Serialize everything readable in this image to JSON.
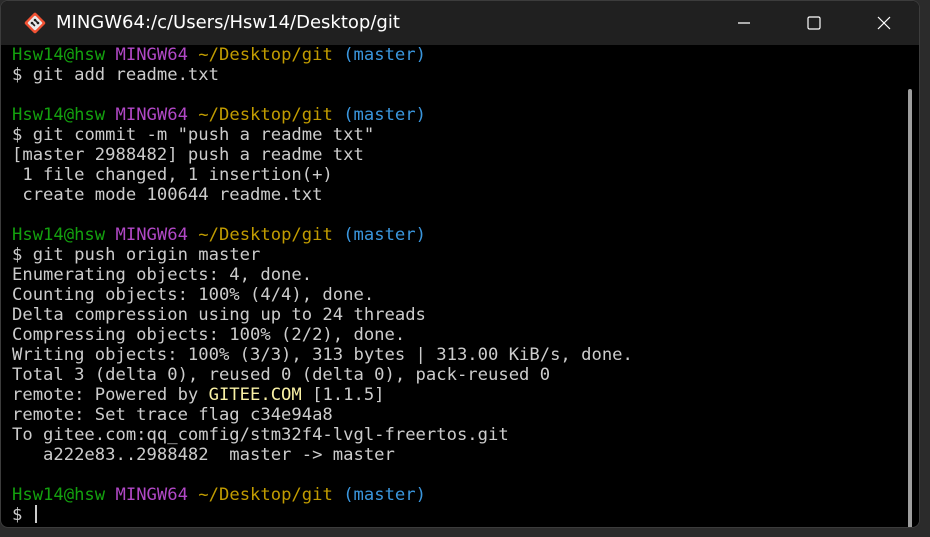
{
  "window": {
    "title": "MINGW64:/c/Users/Hsw14/Desktop/git",
    "app_icon": "git-bash-icon"
  },
  "controls": {
    "minimize_icon": "minimize-icon",
    "maximize_icon": "maximize-icon",
    "close_icon": "close-icon"
  },
  "colors": {
    "user": "#13a10e",
    "host": "#b148c6",
    "path": "#c19c00",
    "branch": "#3a96dd",
    "text": "#cccccc",
    "highlight": "#f9f1a5"
  },
  "prompt": {
    "user": "Hsw14@hsw",
    "host": "MINGW64",
    "path": "~/Desktop/git",
    "branch": "(master)",
    "symbol": "$"
  },
  "lines": [
    {
      "type": "prompt"
    },
    {
      "type": "cmd",
      "text": "git add readme.txt"
    },
    {
      "type": "blank"
    },
    {
      "type": "prompt"
    },
    {
      "type": "cmd",
      "text": "git commit -m \"push a readme txt\""
    },
    {
      "type": "out",
      "text": "[master 2988482] push a readme txt"
    },
    {
      "type": "out",
      "text": " 1 file changed, 1 insertion(+)"
    },
    {
      "type": "out",
      "text": " create mode 100644 readme.txt"
    },
    {
      "type": "blank"
    },
    {
      "type": "prompt"
    },
    {
      "type": "cmd",
      "text": "git push origin master"
    },
    {
      "type": "out",
      "text": "Enumerating objects: 4, done."
    },
    {
      "type": "out",
      "text": "Counting objects: 100% (4/4), done."
    },
    {
      "type": "out",
      "text": "Delta compression using up to 24 threads"
    },
    {
      "type": "out",
      "text": "Compressing objects: 100% (2/2), done."
    },
    {
      "type": "out",
      "text": "Writing objects: 100% (3/3), 313 bytes | 313.00 KiB/s, done."
    },
    {
      "type": "out",
      "text": "Total 3 (delta 0), reused 0 (delta 0), pack-reused 0"
    },
    {
      "type": "remote",
      "prefix": "remote: Powered by ",
      "highlight": "GITEE.COM",
      "suffix": " [1.1.5]"
    },
    {
      "type": "out",
      "text": "remote: Set trace flag c34e94a8"
    },
    {
      "type": "out",
      "text": "To gitee.com:qq_comfig/stm32f4-lvgl-freertos.git"
    },
    {
      "type": "out",
      "text": "   a222e83..2988482  master -> master"
    },
    {
      "type": "blank"
    },
    {
      "type": "prompt"
    },
    {
      "type": "input"
    }
  ],
  "scroll": {
    "position": 0.0,
    "visible_fraction": 1.0
  }
}
